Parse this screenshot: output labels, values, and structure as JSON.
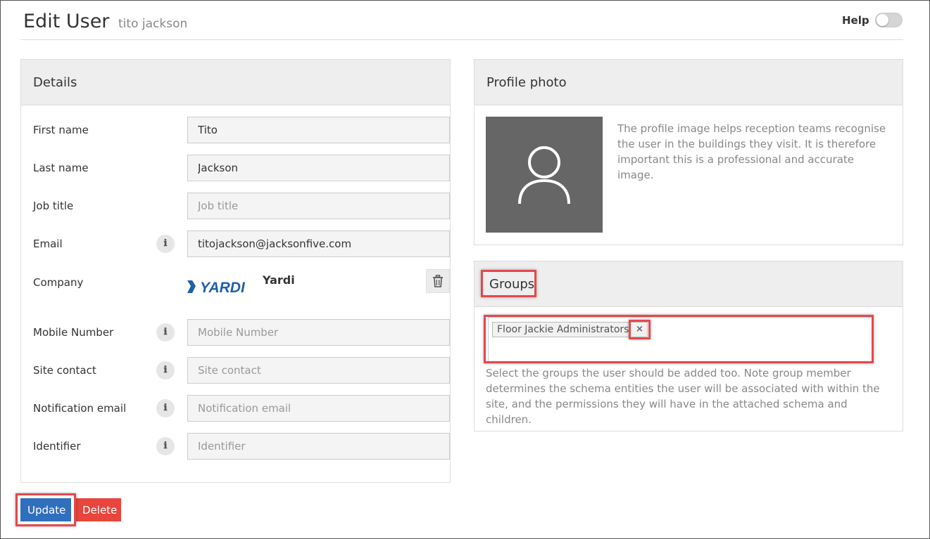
{
  "header": {
    "title": "Edit User",
    "subtitle": "tito jackson",
    "help_label": "Help"
  },
  "details": {
    "title": "Details",
    "fields": [
      {
        "label": "First name",
        "value": "Tito",
        "placeholder": ""
      },
      {
        "label": "Last name",
        "value": "Jackson",
        "placeholder": ""
      },
      {
        "label": "Job title",
        "value": "",
        "placeholder": "Job title"
      },
      {
        "label": "Email",
        "value": "titojackson@jacksonfive.com",
        "placeholder": ""
      },
      {
        "label": "Mobile Number",
        "value": "",
        "placeholder": "Mobile Number"
      },
      {
        "label": "Site contact",
        "value": "",
        "placeholder": "Site contact"
      },
      {
        "label": "Notification email",
        "value": "",
        "placeholder": "Notification email"
      },
      {
        "label": "Identifier",
        "value": "",
        "placeholder": "Identifier"
      }
    ],
    "company": {
      "label": "Company",
      "logo_text": "YARDI",
      "name": "Yardi"
    },
    "info_icon_glyph": "ℹ"
  },
  "profile": {
    "title": "Profile photo",
    "description": "The profile image helps reception teams recognise the user in the buildings they visit. It is therefore important this is a professional and accurate image."
  },
  "groups": {
    "title": "Groups",
    "selected": [
      "Floor Jackie Administrators"
    ],
    "remove_glyph": "×",
    "help_text": "Select the groups the user should be added too. Note group member determines the schema entities the user will be associated with within the site, and the permissions they will have in the attached schema and children."
  },
  "actions": {
    "update_label": "Update",
    "delete_label": "Delete"
  },
  "colors": {
    "primary": "#2f6fbd",
    "danger": "#e8453c",
    "highlight": "#e5484d",
    "yardi_blue": "#1f5fa8"
  }
}
